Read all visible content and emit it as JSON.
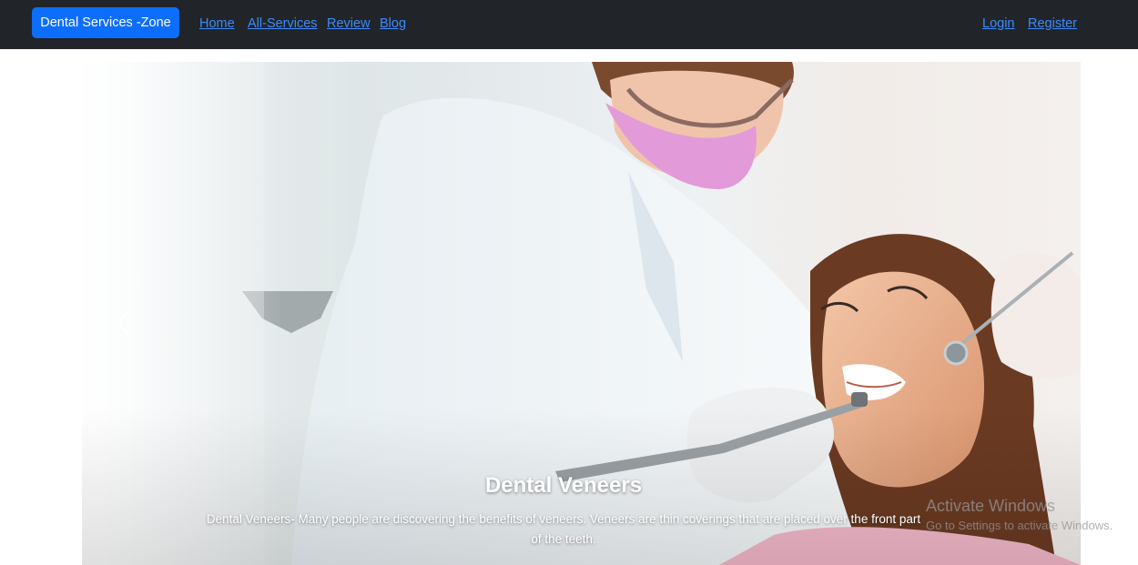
{
  "navbar": {
    "brand": "Dental Services -Zone",
    "links": [
      {
        "label": "Home"
      },
      {
        "label": "All-Services"
      },
      {
        "label": "Review"
      },
      {
        "label": "Blog"
      }
    ],
    "auth": {
      "login": "Login",
      "register": "Register"
    },
    "colors": {
      "background": "#212529",
      "brand": "#0d6efd",
      "link": "#3d8bfd"
    }
  },
  "carousel": {
    "slide": {
      "title": "Dental Veneers",
      "text": "Dental Veneers- Many people are discovering the benefits of veneers. Veneers are thin coverings that are placed over the front part of the teeth."
    },
    "controls": {
      "prev_icon": "chevron-left-icon"
    }
  },
  "os_watermark": {
    "title": "Activate Windows",
    "subtitle": "Go to Settings to activate Windows."
  }
}
